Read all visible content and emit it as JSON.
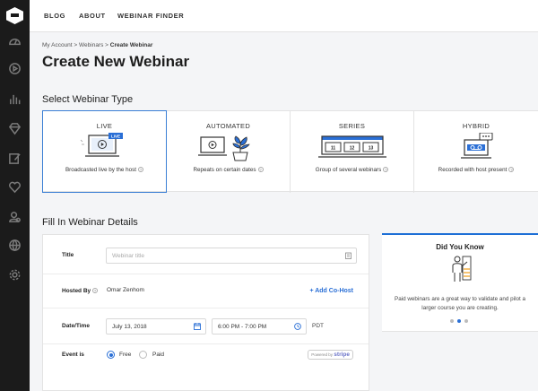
{
  "sidebar": {
    "icons": [
      "dashboard-icon",
      "play-icon",
      "stats-icon",
      "gem-icon",
      "edit-icon",
      "heart-icon",
      "lock-icon",
      "globe-icon",
      "gear-icon"
    ]
  },
  "topnav": {
    "links": [
      "BLOG",
      "ABOUT",
      "WEBINAR FINDER"
    ]
  },
  "breadcrumb": {
    "part1": "My Account",
    "sep": " > ",
    "part2": "Webinars",
    "current": "Create Webinar"
  },
  "page_title": "Create New Webinar",
  "select_type": {
    "heading": "Select Webinar Type",
    "types": [
      {
        "name": "LIVE",
        "desc": "Broadcasted live by the host",
        "badge": "LIVE"
      },
      {
        "name": "AUTOMATED",
        "desc": "Repeats on certain dates"
      },
      {
        "name": "SERIES",
        "desc": "Group of several webinars",
        "nums": [
          "11",
          "12",
          "13"
        ]
      },
      {
        "name": "HYBRID",
        "desc": "Recorded with host present"
      }
    ],
    "help_glyph": "?"
  },
  "details": {
    "heading": "Fill In Webinar Details",
    "title_label": "Title",
    "title_placeholder": "Webinar title",
    "hosted_by_label": "Hosted By",
    "host_name": "Omar Zenhom",
    "add_cohost": "+ Add Co-Host",
    "datetime_label": "Date/Time",
    "date_value": "July 13, 2018",
    "time_value": "6:00 PM - 7:00 PM",
    "timezone": "PDT",
    "event_label": "Event is",
    "option_free": "Free",
    "option_paid": "Paid",
    "selected_option": "Free",
    "stripe_prefix": "Powered by",
    "stripe_brand": "stripe"
  },
  "did_you_know": {
    "title": "Did You Know",
    "text": "Paid webinars are a great way to validate and pilot a larger course you are creating.",
    "active_dot": 1
  },
  "colors": {
    "accent": "#2a6fd6",
    "sidebar": "#1b1b1b",
    "selected_border": "#3a7fd5"
  }
}
